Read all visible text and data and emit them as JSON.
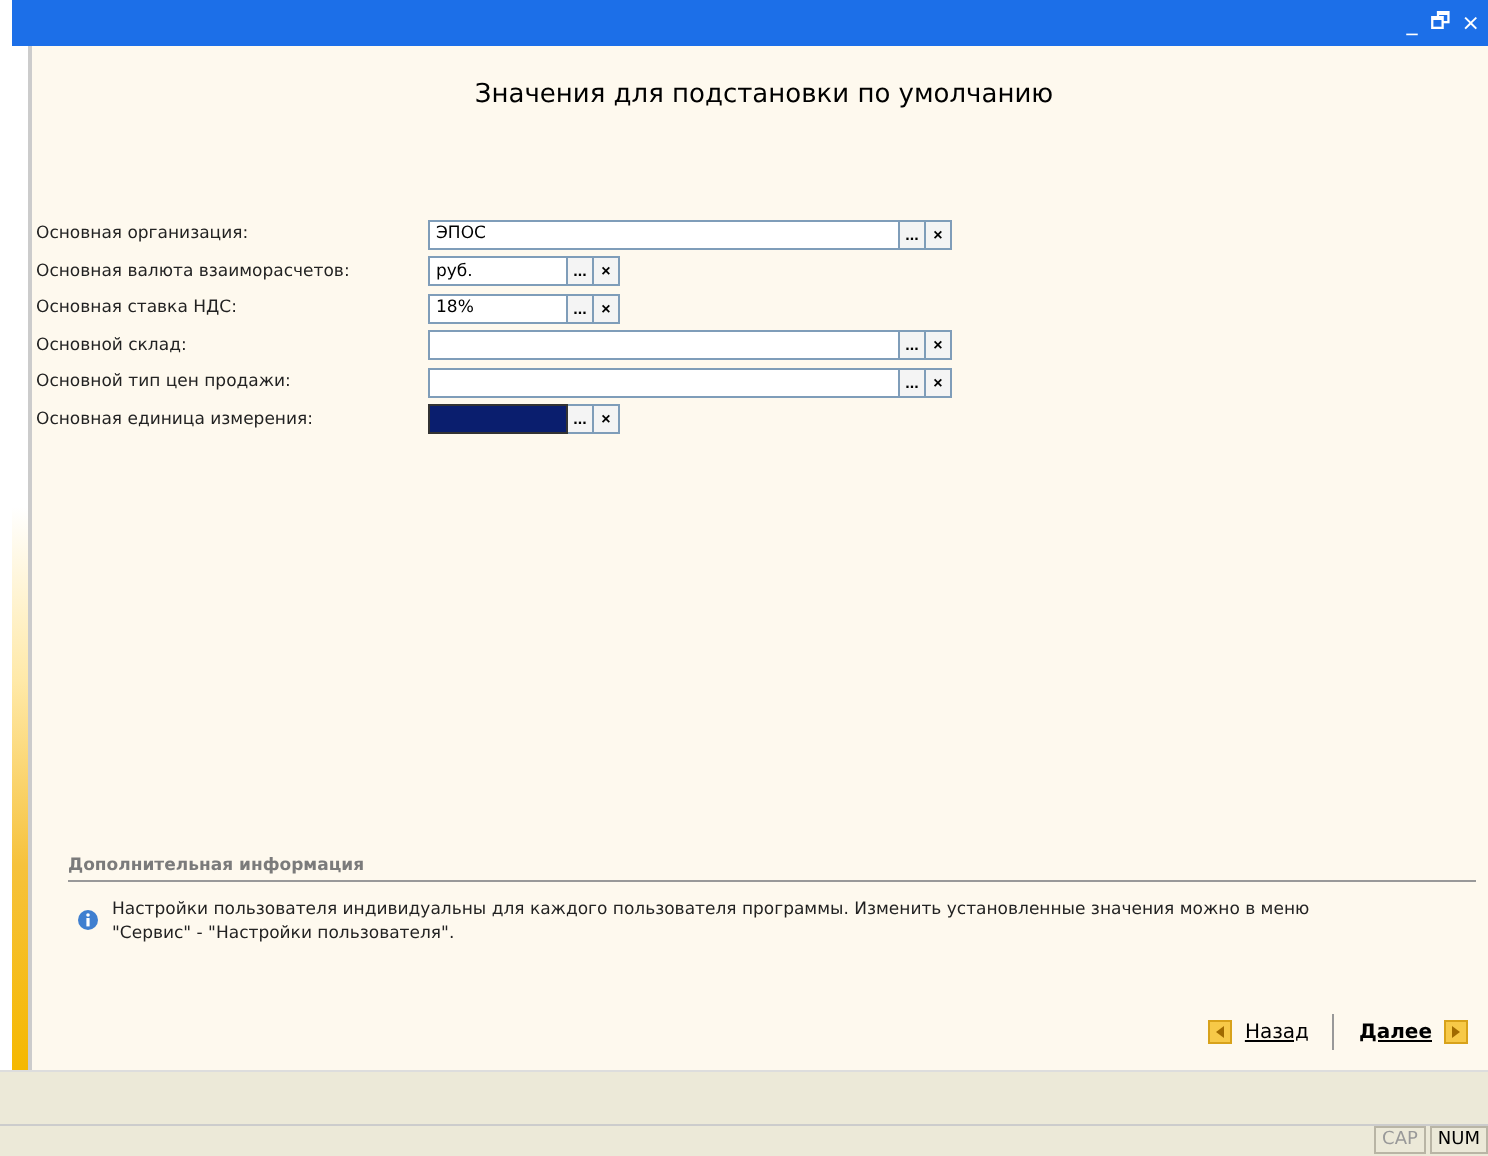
{
  "window": {
    "title": "Значения для подстановки по умолчанию",
    "controls": [
      "_",
      "🗗",
      "×"
    ]
  },
  "fields": [
    {
      "label": "Основная организация:",
      "value": "ЭПОС",
      "kind": "long",
      "selected": false,
      "choose": "...",
      "clear": "×"
    },
    {
      "label": "Основная валюта взаиморасчетов:",
      "value": "руб.",
      "kind": "short",
      "selected": false,
      "choose": "...",
      "clear": "×"
    },
    {
      "label": "Основная ставка НДС:",
      "value": "18%",
      "kind": "short",
      "selected": false,
      "choose": "...",
      "clear": "×"
    },
    {
      "label": "Основной склад:",
      "kind": "long",
      "selected": false,
      "choose": "...",
      "clear": "×"
    },
    {
      "label": "Основной тип цен продажи:",
      "kind": "long",
      "selected": false,
      "choose": "...",
      "clear": "×"
    },
    {
      "label": "Основная единица измерения:",
      "kind": "short",
      "selected": true,
      "choose": "...",
      "clear": "×"
    }
  ],
  "info": {
    "heading": "Дополнительная информация",
    "text": "Настройки пользователя индивидуальны для каждого пользователя программы. Изменить установленные значения можно в меню \"Сервис\" - \"Настройки пользователя\"."
  },
  "navigation": {
    "back": "Назад",
    "next": "Далее"
  },
  "status_bar": [
    {
      "label": "CAP",
      "on": false
    },
    {
      "label": "NUM",
      "on": true
    }
  ]
}
